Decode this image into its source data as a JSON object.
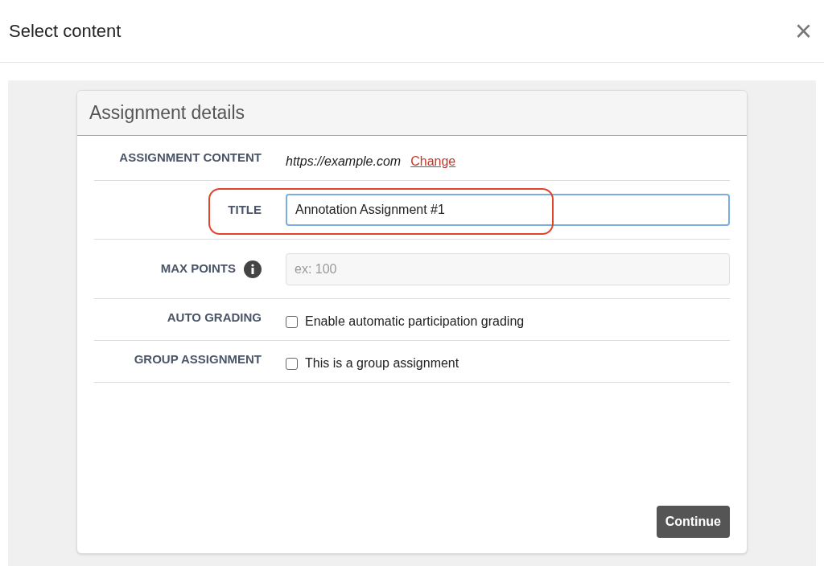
{
  "dialog": {
    "title": "Select content",
    "close_label": "×"
  },
  "card": {
    "title": "Assignment details",
    "rows": [
      {
        "kind": "link",
        "label": "ASSIGNMENT CONTENT",
        "value": "https://example.com",
        "link": "Change",
        "highlighted": false
      },
      {
        "kind": "input",
        "label": "TITLE",
        "value": "Annotation Assignment #1",
        "focused": true,
        "info": false,
        "highlighted": true
      },
      {
        "kind": "input",
        "label": "MAX POINTS",
        "placeholder": "ex: 100",
        "focused": false,
        "info": true,
        "highlighted": false
      },
      {
        "kind": "checkbox",
        "label": "AUTO GRADING",
        "text": "Enable automatic participation grading",
        "checked": false,
        "highlighted": false
      },
      {
        "kind": "checkbox",
        "label": "GROUP ASSIGNMENT",
        "text": "This is a group assignment",
        "checked": false,
        "highlighted": false
      }
    ],
    "button": "Continue"
  }
}
